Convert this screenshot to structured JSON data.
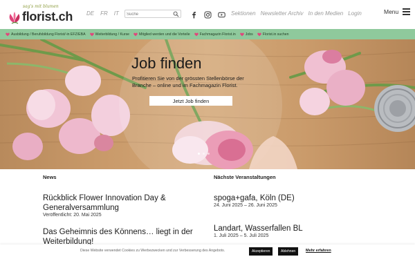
{
  "header": {
    "logo_tagline": "sag's mit blumen",
    "logo_text": "florist.ch",
    "languages": [
      "DE",
      "FR",
      "IT"
    ],
    "search_placeholder": "Suche",
    "social_icons": [
      "facebook-icon",
      "instagram-icon",
      "youtube-icon"
    ],
    "nav": [
      "Sektionen",
      "Newsletter Archiv",
      "In den Medien",
      "Login"
    ],
    "menu_label": "Menu"
  },
  "greenbar": {
    "items": [
      "Ausbildung / Berufsbildung Florist/-in EFZ/EBA",
      "Weiterbildung / Kurse",
      "Mitglied werden und die Vorteile",
      "Fachmagazin Florist.in",
      "Jobs",
      "Florist.in suchen"
    ]
  },
  "hero": {
    "title": "Job finden",
    "text": "Profitieren Sie von der grössten Stellenbörse der Branche – online und im Fachmagazin Florist.",
    "button": "Jetzt Job finden",
    "slides": 3,
    "active_slide": 1
  },
  "news": {
    "heading": "News",
    "items": [
      {
        "title": "Rückblick Flower Innovation Day & Generalversammlung",
        "meta": "Veröffentlicht: 20. Mai 2025"
      },
      {
        "title": "Das Geheimnis des Könnens… liegt in der Weiterbildung!",
        "meta": ""
      }
    ]
  },
  "events": {
    "heading": "Nächste Veranstaltungen",
    "items": [
      {
        "title": "spoga+gafa, Köln (DE)",
        "date": "24. Juni 2025 – 26. Juni 2025"
      },
      {
        "title": "Landart, Wasserfallen BL",
        "date": "1. Juli 2025 – 5. Juli 2025"
      }
    ]
  },
  "cookie": {
    "text": "Diese Website verwendet Cookies zu Werbezwecken und zur Verbesserung des Angebots.",
    "accept": "Akzeptieren",
    "decline": "Ablehnen",
    "more": "Mehr erfahren"
  },
  "colors": {
    "brand_green": "#8fc99c",
    "brand_pink": "#e0457b",
    "logo_olive": "#8a9a3a"
  }
}
